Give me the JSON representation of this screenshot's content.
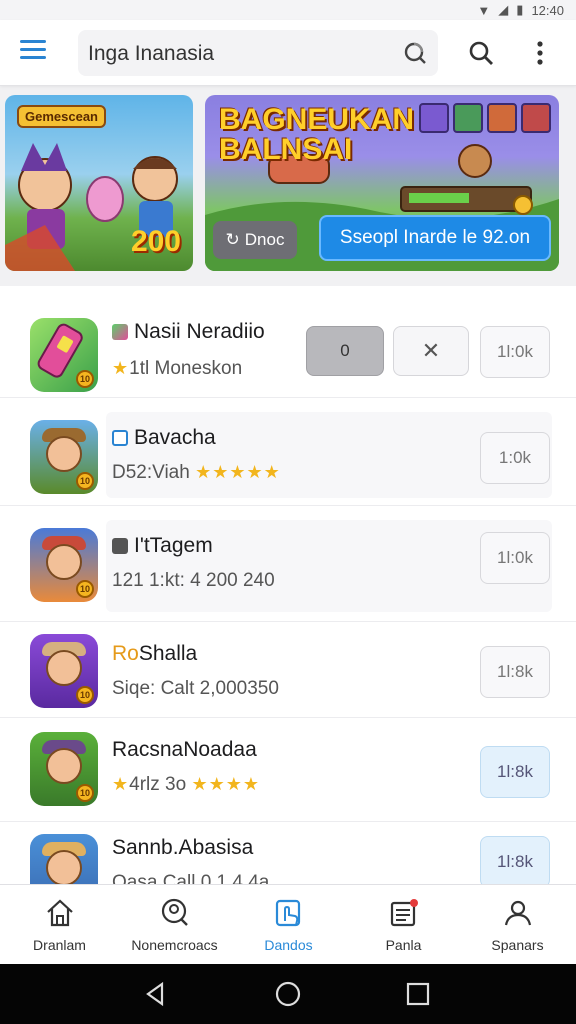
{
  "status": {
    "time": "12:40"
  },
  "search": {
    "text": "Inga Inanasia"
  },
  "banners": {
    "left": {
      "tag": "Gemescean",
      "number": "200"
    },
    "right": {
      "title": "BAGNEUKAN BALNSAI",
      "chip_label": "Dnoc",
      "cta_label": "Sseopl Inarde le 92.on"
    }
  },
  "apps": [
    {
      "title": "Nasii Neradiio",
      "subtitle": "1tl Moneskon",
      "size": "1l:0k",
      "ctl_grey": "0",
      "ctl_x": "✕",
      "icon_colors": [
        "#6ed06a",
        "#e24e9a"
      ]
    },
    {
      "title": "Bavacha",
      "subtitle": "D52:Viah",
      "stars": "★★★★★",
      "size": "1:0k",
      "icon_colors": [
        "#6ab0e8",
        "#5a8a2a"
      ]
    },
    {
      "title": "I'tTagem",
      "subtitle": "121 1:kt: 4 200 240",
      "size": "1l:0k",
      "icon_colors": [
        "#e98a3a",
        "#4a7ad8"
      ]
    },
    {
      "title_prefix": "Ro",
      "title": "Shalla",
      "subtitle": "Siqe: Calt 2,000350",
      "size": "1l:8k",
      "icon_colors": [
        "#8a4ad8",
        "#d68a3a"
      ]
    },
    {
      "title": "RacsnaNoadaa",
      "subtitle": "4rlz 3o",
      "stars": "★★★★",
      "size": "1l:8k",
      "icon_colors": [
        "#5ab03a",
        "#3a7a2a"
      ]
    },
    {
      "title": "Sannb.Abasisa",
      "subtitle": "Qasa Call 0.1 4 4a",
      "size": "1l:8k",
      "icon_colors": [
        "#4a90d8",
        "#e0b060"
      ]
    }
  ],
  "nav": [
    {
      "label": "Dranlam",
      "icon": "home-icon"
    },
    {
      "label": "Nonemcroacs",
      "icon": "search-person-icon"
    },
    {
      "label": "Dandos",
      "icon": "touch-icon",
      "active": true
    },
    {
      "label": "Panla",
      "icon": "news-icon"
    },
    {
      "label": "Spanars",
      "icon": "people-icon"
    }
  ],
  "colors": {
    "accent": "#2a8ad8",
    "cta": "#1e8ae6"
  }
}
